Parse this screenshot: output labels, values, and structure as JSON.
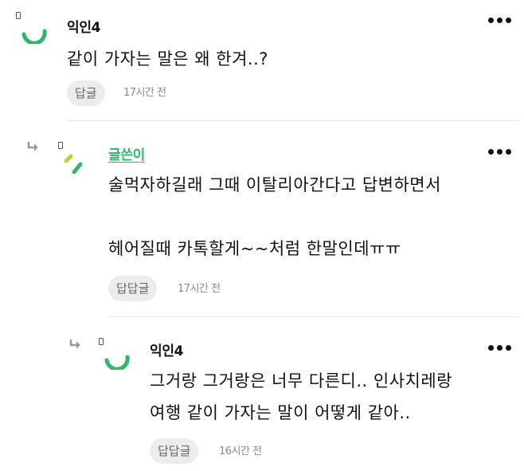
{
  "comments": [
    {
      "author": "익인4",
      "body": "같이 가자는 말은 왜 한겨..?",
      "reply_label": "답글",
      "time": "17시간 전",
      "is_reply": false
    },
    {
      "author": "글쓴이",
      "body": "술먹자하길래 그때 이탈리아간다고 답변하면서\n\n헤어질때 카톡할게~~처럼 한말인데ㅠㅠ",
      "reply_label": "답답글",
      "time": "17시간 전",
      "is_reply": true
    },
    {
      "author": "익인4",
      "body": "그거랑 그거랑은 너무 다른디.. 인사치레랑\n여행 같이 가자는 말이 어떻게 같아..",
      "reply_label": "답답글",
      "time": "16시간 전",
      "is_reply": true
    }
  ],
  "colors": {
    "accent_green": "#2fb66a",
    "reply_button_bg": "#ececec",
    "muted_text": "#888888"
  },
  "icons": {
    "more": "more-options-icon",
    "reply_arrow": "reply-arrow-icon",
    "avatar": "avatar-icon"
  }
}
